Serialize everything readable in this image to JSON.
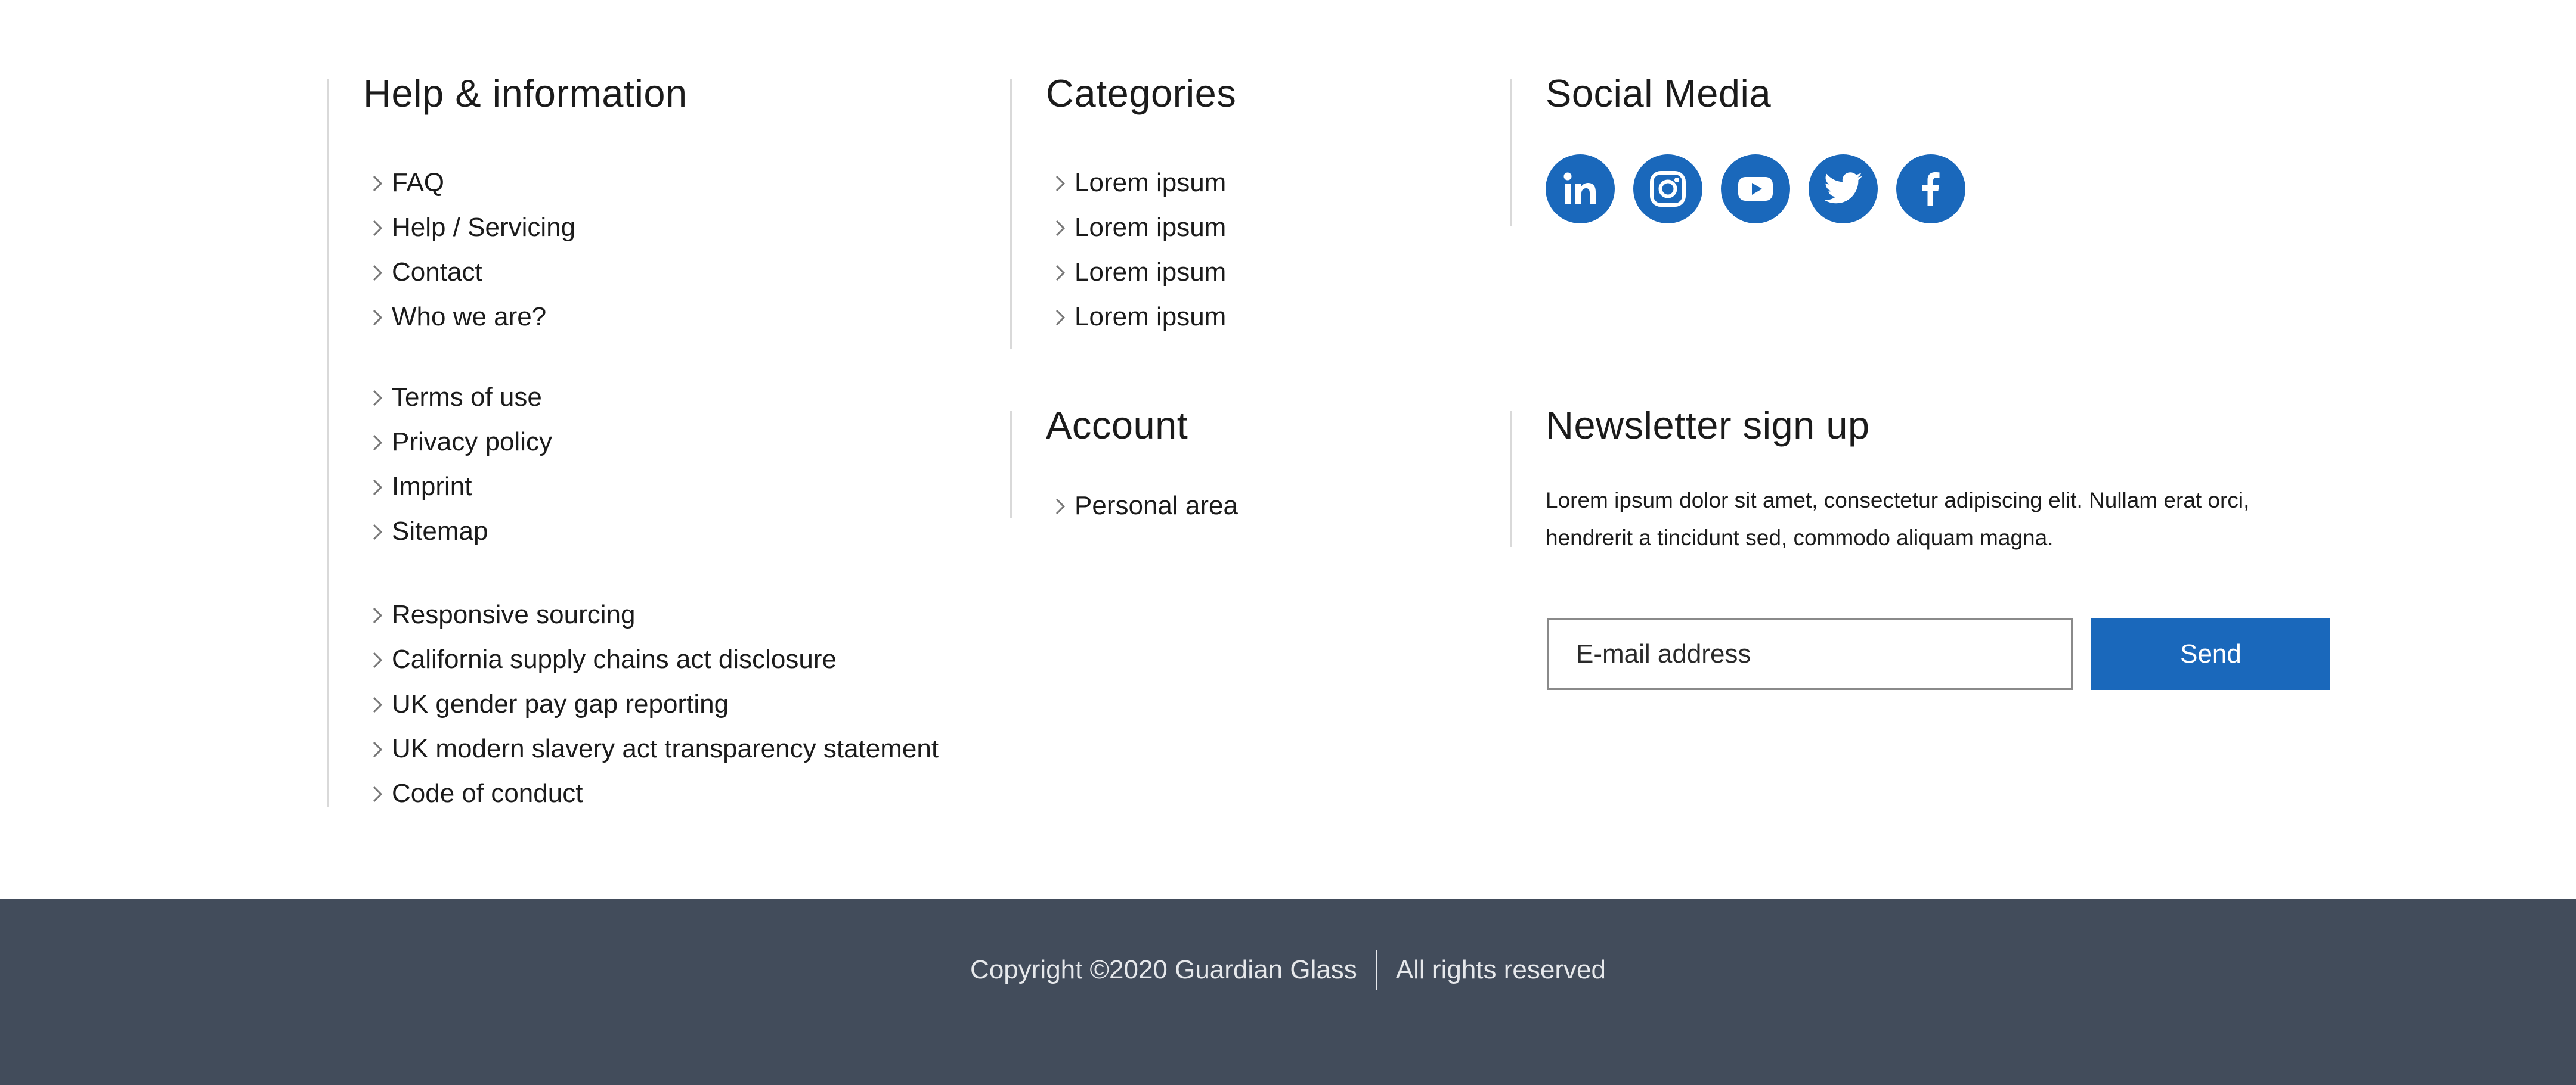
{
  "help": {
    "title": "Help & information",
    "groups": [
      [
        "FAQ",
        "Help / Servicing",
        "Contact",
        "Who we are?"
      ],
      [
        "Terms of use",
        "Privacy policy",
        "Imprint",
        "Sitemap"
      ],
      [
        "Responsive sourcing",
        "California supply chains act disclosure",
        "UK gender pay gap reporting",
        "UK modern slavery act transparency statement",
        "Code of conduct"
      ]
    ]
  },
  "categories": {
    "title": "Categories",
    "items": [
      "Lorem ipsum",
      "Lorem ipsum",
      "Lorem ipsum",
      "Lorem ipsum"
    ]
  },
  "account": {
    "title": "Account",
    "items": [
      "Personal area"
    ]
  },
  "social": {
    "title": "Social Media",
    "icons": [
      "linkedin-icon",
      "instagram-icon",
      "youtube-icon",
      "twitter-icon",
      "facebook-icon"
    ],
    "color": "#1a68bb"
  },
  "newsletter": {
    "title": "Newsletter sign up",
    "text": "Lorem ipsum dolor sit amet, consectetur adipiscing elit. Nullam erat orci, hendrerit a tincidunt sed, commodo aliquam magna.",
    "email_placeholder": "E-mail address",
    "send_label": "Send"
  },
  "footer": {
    "copyright": "Copyright ©2020 Guardian Glass",
    "rights": "All rights reserved",
    "background": "#424c5b"
  }
}
